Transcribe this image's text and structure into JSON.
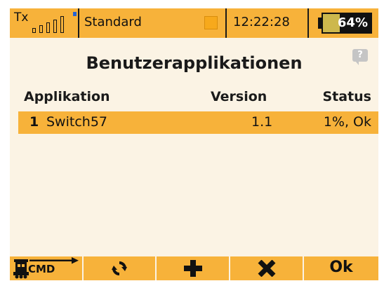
{
  "status_bar": {
    "tx_label": "Tx",
    "model_name": "Standard",
    "time": "12:22:28",
    "battery_percent": "64%",
    "battery_level": 0.64,
    "accent_color": "#f7b23a",
    "signal_bars": 5
  },
  "page": {
    "title": "Benutzerapplikationen",
    "help_icon": "?"
  },
  "table": {
    "headers": {
      "application": "Applikation",
      "version": "Version",
      "status": "Status"
    },
    "rows": [
      {
        "index": "1",
        "name": "Switch57",
        "version": "1.1",
        "status": "1%, Ok"
      }
    ]
  },
  "toolbar": {
    "cmd_label": "CMD",
    "cmd_icon": "train-cmd-icon",
    "refresh_icon": "refresh-icon",
    "add_icon": "plus-icon",
    "delete_icon": "x-icon",
    "ok_label": "Ok"
  }
}
